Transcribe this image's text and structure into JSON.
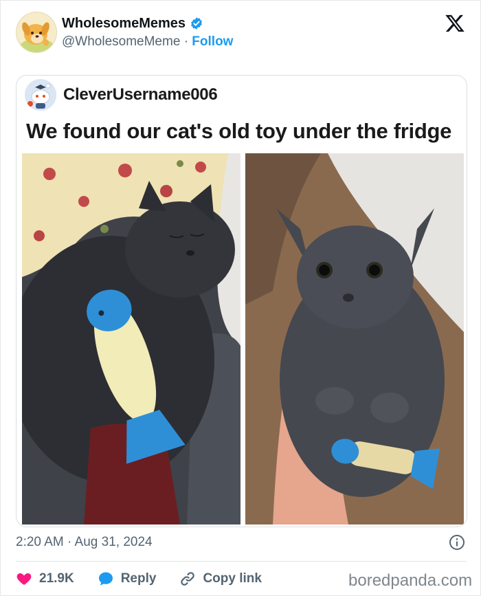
{
  "header": {
    "display_name": "WholesomeMemes",
    "handle": "@WholesomeMeme",
    "separator": "·",
    "follow_label": "Follow",
    "avatar_icon": "shiba-dog-avatar",
    "verified_icon": "verified-badge-icon",
    "close_icon": "x-logo-icon"
  },
  "inner_post": {
    "username": "CleverUsername006",
    "text": "We found our cat's old toy under the fridge",
    "avatar_icon": "reddit-snoo-avatar",
    "images": [
      {
        "name": "sleeping-cat-with-fish-toy-photo"
      },
      {
        "name": "cat-held-in-arm-with-fish-toy-photo"
      }
    ]
  },
  "footer": {
    "timestamp": "2:20 AM · Aug 31, 2024",
    "info_icon": "info-icon",
    "like_count": "21.9K",
    "reply_label": "Reply",
    "copy_link_label": "Copy link",
    "watermark": "boredpanda.com"
  },
  "colors": {
    "accent": "#1d9bf0",
    "like": "#f91880",
    "text_secondary": "#536471"
  }
}
